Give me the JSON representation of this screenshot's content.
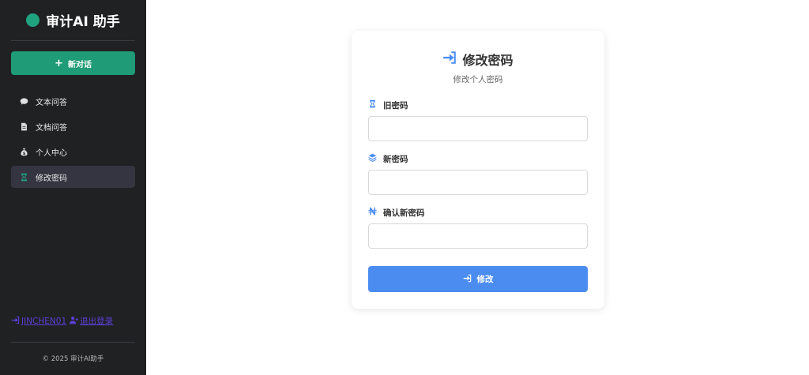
{
  "sidebar": {
    "brand_title": "审计AI 助手",
    "new_chat_label": "新对话",
    "items": [
      {
        "label": "文本问答",
        "icon": "chat-bubble-icon"
      },
      {
        "label": "文档问答",
        "icon": "document-icon"
      },
      {
        "label": "个人中心",
        "icon": "money-bag-icon"
      },
      {
        "label": "修改密码",
        "icon": "hourglass-icon",
        "active": true
      }
    ],
    "username": "JINCHEN01",
    "logout_label": "退出登录",
    "footer": "© 2025 审计AI助手"
  },
  "card": {
    "title": "修改密码",
    "subtitle": "修改个人密码",
    "old_password": {
      "label": "旧密码",
      "value": "",
      "placeholder": ""
    },
    "new_password": {
      "label": "新密码",
      "value": "",
      "placeholder": ""
    },
    "confirm_password": {
      "label": "确认新密码",
      "value": "",
      "placeholder": ""
    },
    "submit_label": "修改"
  },
  "colors": {
    "sidebar_bg": "#202123",
    "accent_green": "#1f9b77",
    "accent_blue": "#4a8cf0",
    "active_item_bg": "#343541",
    "link_purple": "#5b3fd6"
  }
}
